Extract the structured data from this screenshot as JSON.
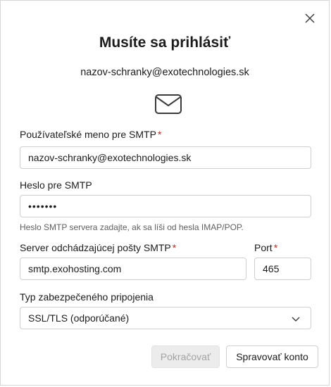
{
  "dialog": {
    "title": "Musíte sa prihlásiť",
    "email": "nazov-schranky@exotechnologies.sk",
    "icons": {
      "close": "close-icon",
      "envelope": "envelope-icon",
      "chevron": "chevron-down-icon"
    },
    "required_marker": "*"
  },
  "username": {
    "label": "Používateľské meno pre SMTP",
    "value": "nazov-schranky@exotechnologies.sk"
  },
  "password": {
    "label": "Heslo pre SMTP",
    "value": "•••••••",
    "hint": "Heslo SMTP servera zadajte, ak sa líši od hesla IMAP/POP."
  },
  "server": {
    "label": "Server odchádzajúcej pošty SMTP",
    "value": "smtp.exohosting.com"
  },
  "port": {
    "label": "Port",
    "value": "465"
  },
  "security": {
    "label": "Typ zabezpečeného pripojenia",
    "selected": "SSL/TLS (odporúčané)"
  },
  "buttons": {
    "continue": "Pokračovať",
    "manage": "Spravovať konto"
  },
  "colors": {
    "required": "#c42b1c",
    "border": "#cfcfcf",
    "disabled_bg": "#ececec",
    "disabled_text": "#a3a3a3"
  }
}
